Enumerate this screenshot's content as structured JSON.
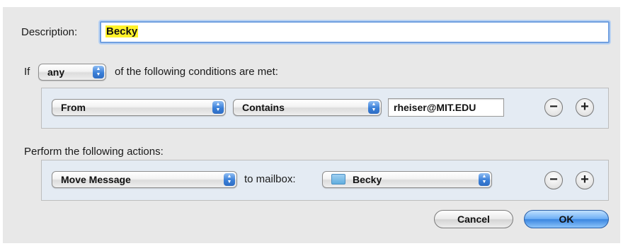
{
  "description": {
    "label": "Description:",
    "value": "Becky"
  },
  "conditions": {
    "prefix": "If",
    "match_select": "any",
    "suffix": "of the following conditions are met:",
    "rule": {
      "field_select": "From",
      "operator_select": "Contains",
      "value": "rheiser@MIT.EDU",
      "remove_label": "−",
      "add_label": "+"
    }
  },
  "actions": {
    "heading": "Perform the following actions:",
    "rule": {
      "action_select": "Move Message",
      "connector": "to mailbox:",
      "mailbox_select": "Becky",
      "remove_label": "−",
      "add_label": "+"
    }
  },
  "buttons": {
    "cancel": "Cancel",
    "ok": "OK"
  },
  "icons": {
    "stepper": "popup-stepper-icon",
    "folder": "folder-icon"
  }
}
